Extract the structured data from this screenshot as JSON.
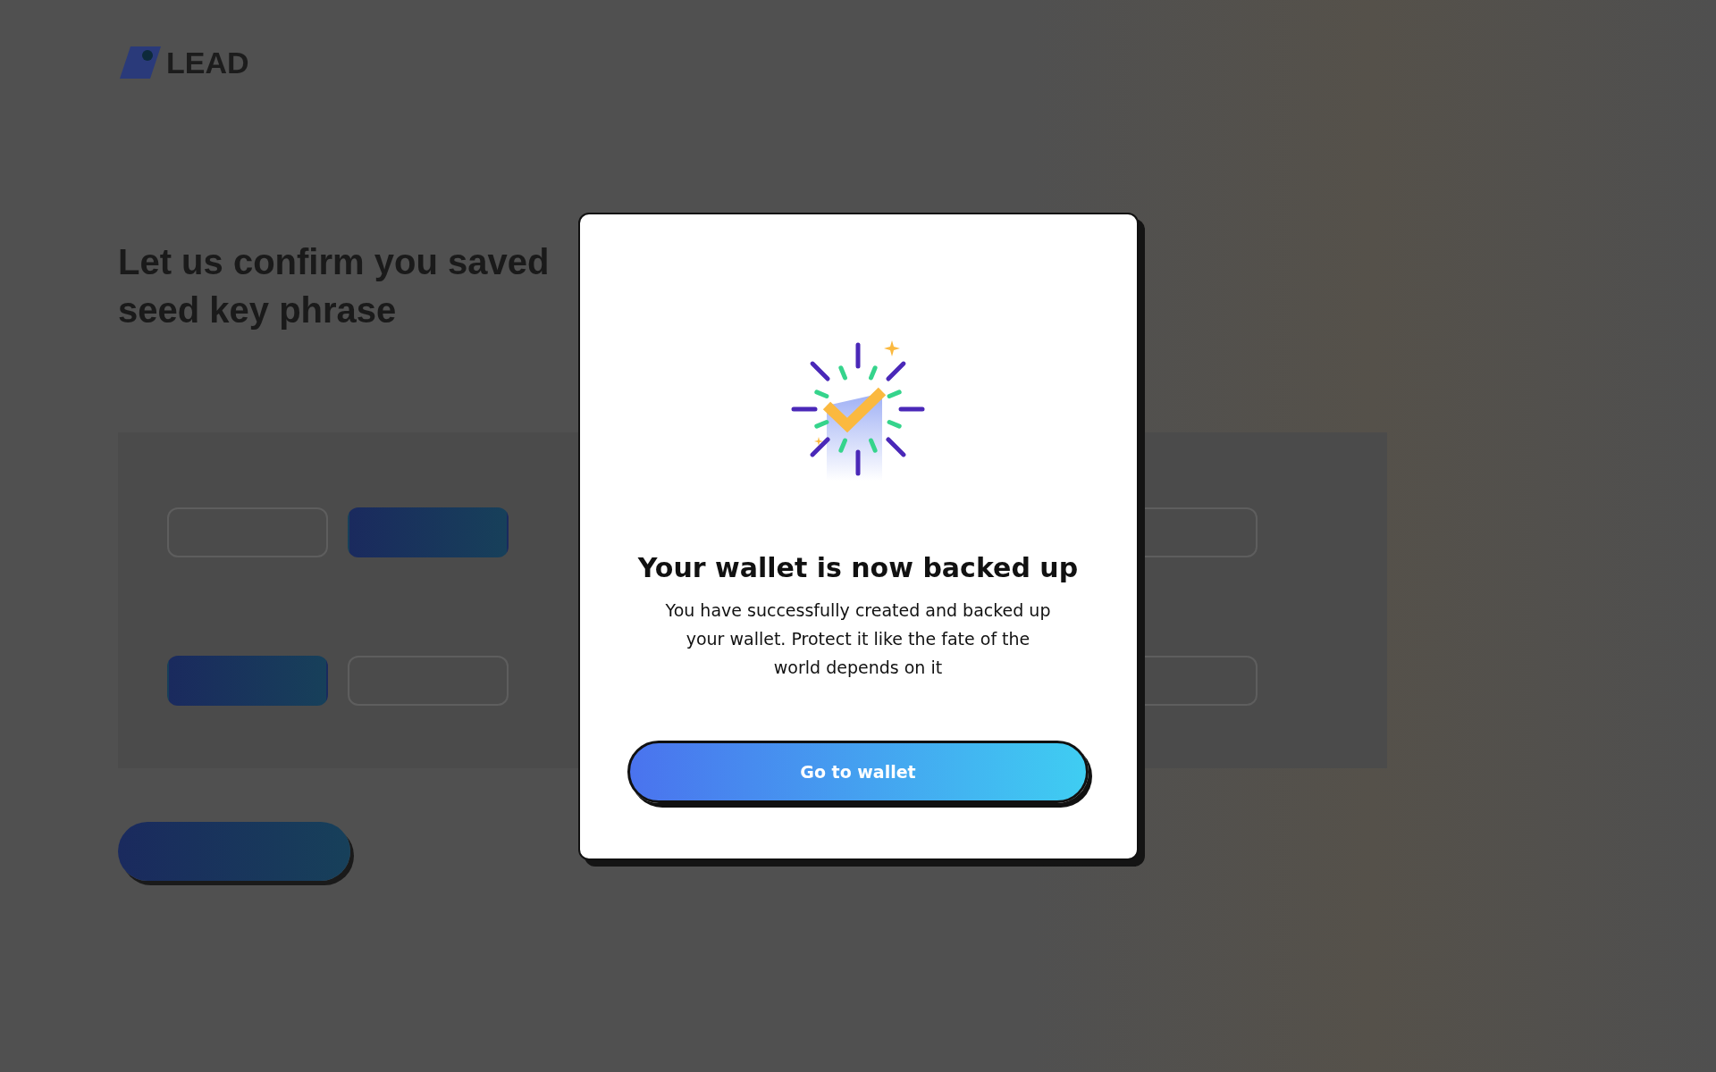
{
  "background": {
    "logo": "LEAD",
    "heading_lines": [
      "Let us confirm you saved",
      "seed key phrase"
    ],
    "word_rows": [
      [
        {
          "selected": false
        },
        {
          "selected": true
        },
        {
          "selected": false
        }
      ],
      [
        {
          "selected": true
        },
        {
          "selected": false
        },
        {
          "selected": false
        }
      ]
    ]
  },
  "dialog": {
    "title": "Your wallet is now backed up",
    "message": "You have successfully created and backed up your wallet. Protect it like the fate of the world depends on it",
    "button": "Go to wallet"
  }
}
